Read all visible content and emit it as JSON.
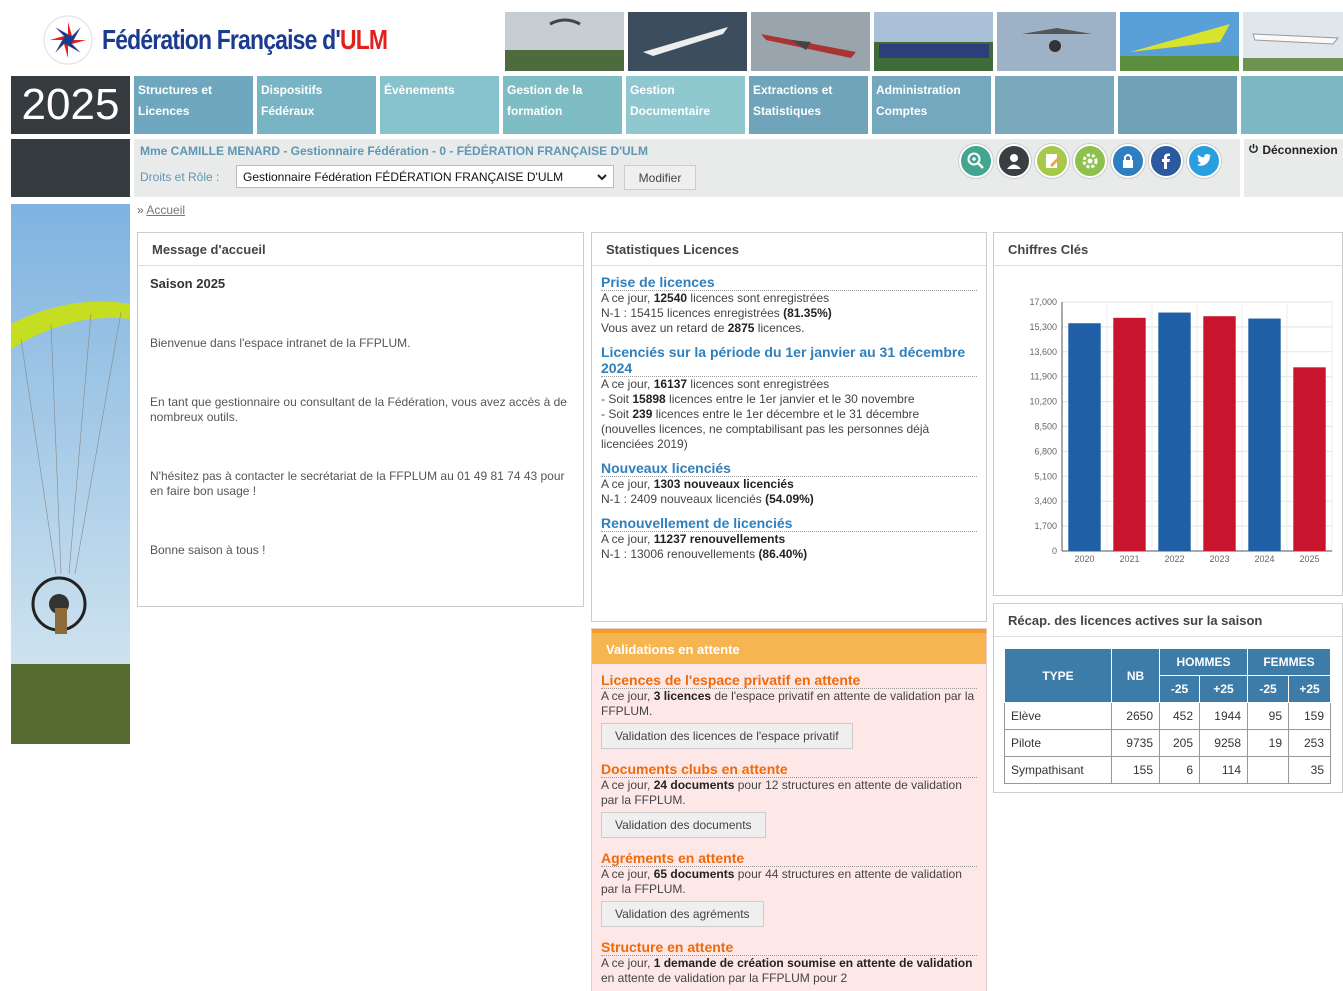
{
  "header": {
    "logo_text_main": "Fédération Française d'",
    "logo_text_accent": "ULM"
  },
  "nav": {
    "year": "2025",
    "items": [
      {
        "label": "Structures et Licences"
      },
      {
        "label": "Dispositifs Fédéraux"
      },
      {
        "label": "Évènements"
      },
      {
        "label": "Gestion de la formation"
      },
      {
        "label": "Gestion Documentaire"
      },
      {
        "label": "Extractions et Statistiques"
      },
      {
        "label": "Administration Comptes"
      },
      {
        "label": ""
      },
      {
        "label": ""
      },
      {
        "label": ""
      }
    ]
  },
  "userbar": {
    "user_line": "Mme CAMILLE MENARD - Gestionnaire Fédération - 0 - FÉDÉRATION FRANÇAISE D'ULM",
    "droits_label": "Droits et Rôle :",
    "role_value": "Gestionnaire Fédération FÉDÉRATION FRANÇAISE D'ULM",
    "modifier_label": "Modifier",
    "deconnexion_label": "Déconnexion",
    "icons": [
      "search-zoom-icon",
      "user-profile-icon",
      "edit-note-icon",
      "settings-gear-icon",
      "lock-icon",
      "facebook-icon",
      "twitter-icon"
    ]
  },
  "breadcrumb": {
    "home": "Accueil"
  },
  "message": {
    "title": "Message d'accueil",
    "season": "Saison 2025",
    "paragraphs": [
      "Bienvenue dans l'espace intranet de la FFPLUM.",
      "En tant que gestionnaire ou consultant de la Fédération, vous avez accès à de nombreux outils.",
      "N'hésitez pas à contacter le secrétariat de la FFPLUM au 01 49 81 74 43 pour en faire bon usage !",
      "Bonne saison à tous !"
    ]
  },
  "stats": {
    "title": "Statistiques Licences",
    "sections": [
      {
        "heading": "Prise de licences",
        "lines": [
          {
            "pre": "A ce jour, ",
            "bold": "12540",
            "post": " licences sont enregistrées"
          },
          {
            "pre": "N-1 : 15415 licences enregistrées ",
            "bold": "(81.35%)",
            "post": ""
          },
          {
            "pre": "Vous avez un retard de ",
            "bold": "2875",
            "post": " licences."
          }
        ]
      },
      {
        "heading": "Licenciés sur la période du 1er janvier au 31 décembre 2024",
        "lines": [
          {
            "pre": "A ce jour, ",
            "bold": "16137",
            "post": " licences sont enregistrées"
          },
          {
            "pre": "- Soit ",
            "bold": "15898",
            "post": " licences entre le 1er janvier et le 30 novembre"
          },
          {
            "pre": "- Soit ",
            "bold": "239",
            "post": " licences entre le 1er décembre et le 31 décembre"
          },
          {
            "pre": "(nouvelles licences, ne comptabilisant pas les personnes déjà licenciées 2019)",
            "bold": "",
            "post": ""
          }
        ]
      },
      {
        "heading": "Nouveaux licenciés",
        "lines": [
          {
            "pre": "A ce jour, ",
            "bold": "1303 nouveaux licenciés",
            "post": ""
          },
          {
            "pre": "N-1 : 2409 nouveaux licenciés ",
            "bold": "(54.09%)",
            "post": ""
          }
        ]
      },
      {
        "heading": "Renouvellement de licenciés",
        "lines": [
          {
            "pre": "A ce jour, ",
            "bold": "11237 renouvellements",
            "post": ""
          },
          {
            "pre": "N-1 : 13006 renouvellements ",
            "bold": "(86.40%)",
            "post": ""
          }
        ]
      }
    ]
  },
  "chart_panel": {
    "title": "Chiffres Clés"
  },
  "chart_data": {
    "type": "bar",
    "categories": [
      "2020",
      "2021",
      "2022",
      "2023",
      "2024",
      "2025"
    ],
    "values": [
      15550,
      15920,
      16280,
      16030,
      15870,
      12540
    ],
    "colors": [
      "#1f5fa6",
      "#c9142e",
      "#1f5fa6",
      "#c9142e",
      "#1f5fa6",
      "#c9142e"
    ],
    "yticks": [
      "0",
      "1,700",
      "3,400",
      "5,100",
      "6,800",
      "8,500",
      "10,200",
      "11,900",
      "13,600",
      "15,300",
      "17,000"
    ],
    "ylim": [
      0,
      17000
    ],
    "grid": true
  },
  "recap": {
    "title": "Récap. des licences actives sur la saison",
    "headers": {
      "type": "TYPE",
      "nb": "NB",
      "hommes": "HOMMES",
      "femmes": "FEMMES",
      "m25": "-25",
      "p25": "+25",
      "fm25": "-25",
      "fp25": "+25"
    },
    "rows": [
      {
        "type": "Elève",
        "nb": "2650",
        "hm": "452",
        "hp": "1944",
        "fm": "95",
        "fp": "159"
      },
      {
        "type": "Pilote",
        "nb": "9735",
        "hm": "205",
        "hp": "9258",
        "fm": "19",
        "fp": "253"
      },
      {
        "type": "Sympathisant",
        "nb": "155",
        "hm": "6",
        "hp": "114",
        "fm": "",
        "fp": "35"
      }
    ]
  },
  "validations": {
    "title": "Validations en attente",
    "sections": [
      {
        "heading": "Licences de l'espace privatif en attente",
        "pre": "A ce jour, ",
        "bold": "3 licences",
        "post": " de l'espace privatif en attente de validation par la FFPLUM.",
        "button": "Validation des licences de l'espace privatif"
      },
      {
        "heading": "Documents clubs en attente",
        "pre": "A ce jour, ",
        "bold": "24 documents",
        "post": " pour 12 structures en attente de validation par la FFPLUM.",
        "button": "Validation des documents"
      },
      {
        "heading": "Agréments en attente",
        "pre": "A ce jour, ",
        "bold": "65 documents",
        "post": " pour 44 structures en attente de validation par la FFPLUM.",
        "button": "Validation des agréments"
      },
      {
        "heading": "Structure en attente",
        "pre": "A ce jour, ",
        "bold": "1 demande de création soumise en attente de validation",
        "post": " en attente de validation par la FFPLUM pour 2",
        "button": ""
      }
    ]
  }
}
